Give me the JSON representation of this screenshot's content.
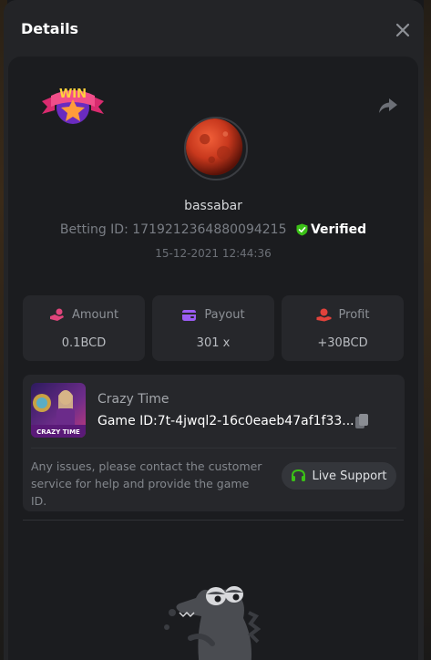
{
  "modal": {
    "title": "Details"
  },
  "player": {
    "username": "bassabar",
    "betting_id_label": "Betting ID:",
    "betting_id": "1719212364880094215",
    "verified_label": "Verified",
    "timestamp": "15-12-2021 12:44:36"
  },
  "badge": {
    "text": "WIN"
  },
  "stats": [
    {
      "label": "Amount",
      "value": "0.1BCD",
      "icon": "hand-coins-icon",
      "color": "#e0457b"
    },
    {
      "label": "Payout",
      "value": "301 x",
      "icon": "wallet-icon",
      "color": "#9b5cf3"
    },
    {
      "label": "Profit",
      "value": "+30BCD",
      "icon": "hand-money-icon",
      "color": "#e2423b"
    }
  ],
  "game": {
    "name": "Crazy Time",
    "id_label": "Game ID:",
    "id_value": "7t-4jwql2-16c0eaeb47af1f33...",
    "thumb_text": "CRAZY TIME"
  },
  "support": {
    "message": "Any issues, please contact the customer service for help and provide the game ID.",
    "button_label": "Live Support"
  },
  "colors": {
    "verified": "#3bc117",
    "support_icon": "#3bc117",
    "background": "#232427",
    "card": "#26272b"
  }
}
